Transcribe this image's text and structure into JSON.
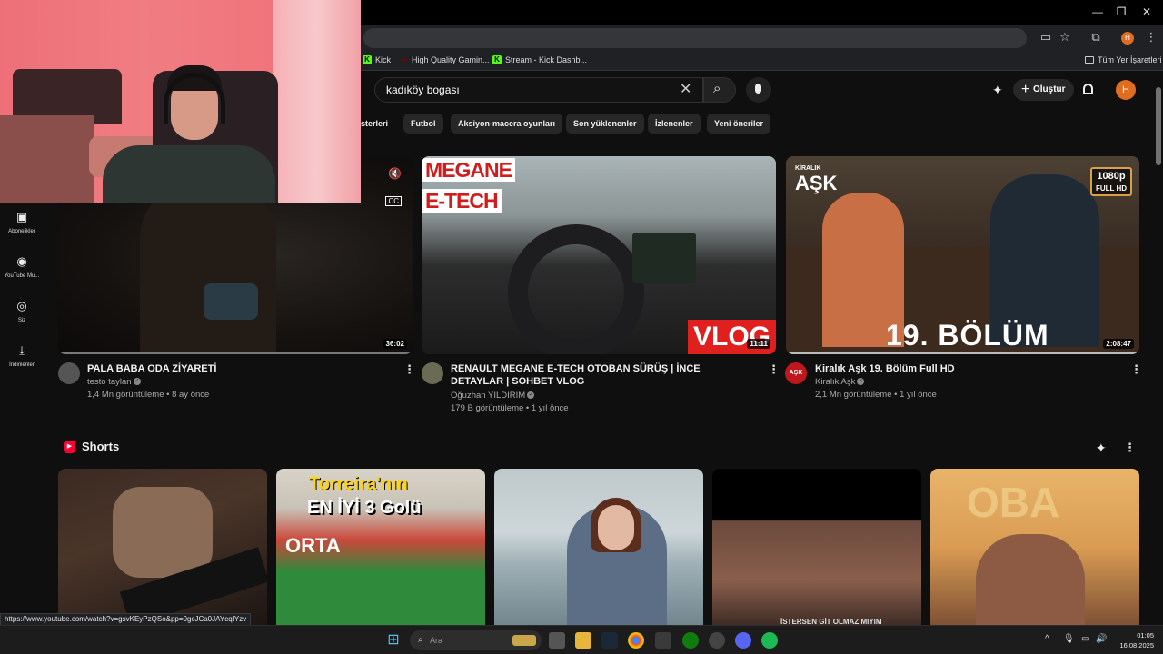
{
  "window": {
    "minimize": "—",
    "maximize": "❐",
    "close": "✕"
  },
  "toolbar": {
    "cast_icon": "▭",
    "star_icon": "☆",
    "ext_icon": "⧉",
    "profile_initial": "H",
    "menu_icon": "⋮"
  },
  "bookmarks": {
    "items": [
      {
        "label": "Kick",
        "icon": "K"
      },
      {
        "label": "High Quality Gamin...",
        "icon": ""
      },
      {
        "label": "Stream - Kick Dashb...",
        "icon": "K"
      }
    ],
    "all_bookmarks": "Tüm Yer İşaretleri"
  },
  "header": {
    "search_value": "kadıköy bogası",
    "clear_icon": "✕",
    "search_icon": "⌕",
    "mic_icon": "🎤",
    "create_label": "Oluştur",
    "create_plus": "+",
    "bell_icon": "🔔",
    "avatar_initial": "H"
  },
  "chips": [
    "sterleri",
    "Futbol",
    "Aksiyon-macera oyunları",
    "Son yüklenenler",
    "İzlenenler",
    "Yeni öneriler"
  ],
  "sidebar": [
    {
      "label": "Abonelikler",
      "icon": "▣"
    },
    {
      "label": "YouTube Mu...",
      "icon": "◉"
    },
    {
      "label": "Siz",
      "icon": "◎"
    },
    {
      "label": "İndirilenler",
      "icon": "⤓"
    }
  ],
  "videos": [
    {
      "title": "PALA BABA ODA ZİYARETİ",
      "channel": "testo taylan",
      "meta": "1,4 Mn görüntüleme • 8 ay önce",
      "duration": "36:02",
      "watched_fraction": 1.0
    },
    {
      "title": "RENAULT MEGANE E-TECH OTOBAN SÜRÜŞ | İNCE DETAYLAR | SOHBET VLOG",
      "channel": "Oğuzhan YILDIRIM",
      "meta": "179 B görüntüleme • 1 yıl önce",
      "duration": "11:11",
      "thumb_text_1": "MEGANE",
      "thumb_text_2": "E-TECH",
      "thumb_badge": "VLOG"
    },
    {
      "title": "Kiralık Aşk 19. Bölüm Full HD",
      "channel": "Kiralık Aşk",
      "meta": "2,1 Mn görüntüleme • 1 yıl önce",
      "duration": "2:08:47",
      "thumb_logo": "AŞK",
      "thumb_logo_small": "KİRALIK",
      "thumb_hd_1": "1080p",
      "thumb_hd_2": "FULL HD",
      "thumb_episode": "19. BÖLÜM",
      "channel_avatar_text": "AŞK"
    }
  ],
  "shorts": {
    "title": "Shorts",
    "items": [
      {
        "thumb_text": ""
      },
      {
        "thumb_text_1": "Torreira'nın",
        "thumb_text_2": "EN İYİ 3 Golü",
        "thumb_text_3": "ORTA"
      },
      {
        "thumb_text": ""
      },
      {
        "thumb_text": "İSTERSEN GİT OLMAZ MIYIM"
      },
      {
        "thumb_text": "OBA"
      }
    ]
  },
  "status_url": "https://www.youtube.com/watch?v=gsvKEyPzQSo&pp=0gcJCa0JAYcqIYzv",
  "taskbar": {
    "start_icon": "⊞",
    "search_placeholder": "Ara",
    "search_icon": "⌕",
    "time": "01:05",
    "date": "16.08.2025",
    "tray_up": "^",
    "mic": "🎙",
    "net": "▭",
    "vol": "🔊"
  }
}
